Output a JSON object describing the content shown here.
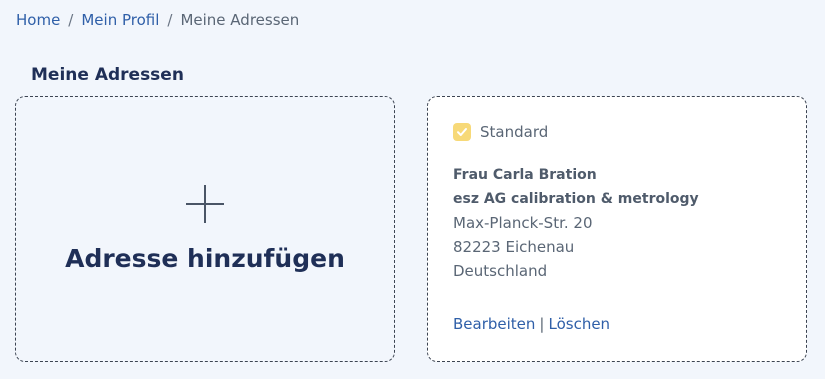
{
  "breadcrumb": {
    "items": [
      "Home",
      "Mein Profil"
    ],
    "current": "Meine Adressen",
    "separator": "/"
  },
  "page": {
    "title": "Meine Adressen"
  },
  "add_card": {
    "label": "Adresse hinzufügen",
    "icon": "plus-icon"
  },
  "address": {
    "default_label": "Standard",
    "default_checked": true,
    "name": "Frau Carla Bration",
    "company": "esz AG calibration & metrology",
    "street": "Max-Planck-Str. 20",
    "city": "82223 Eichenau",
    "country": "Deutschland",
    "edit_label": "Bearbeiten",
    "delete_label": "Löschen",
    "action_separator": "|"
  },
  "colors": {
    "background": "#f2f6fc",
    "link": "#2f5fa8",
    "heading": "#1f2f57",
    "checkbox": "#f7d978"
  }
}
